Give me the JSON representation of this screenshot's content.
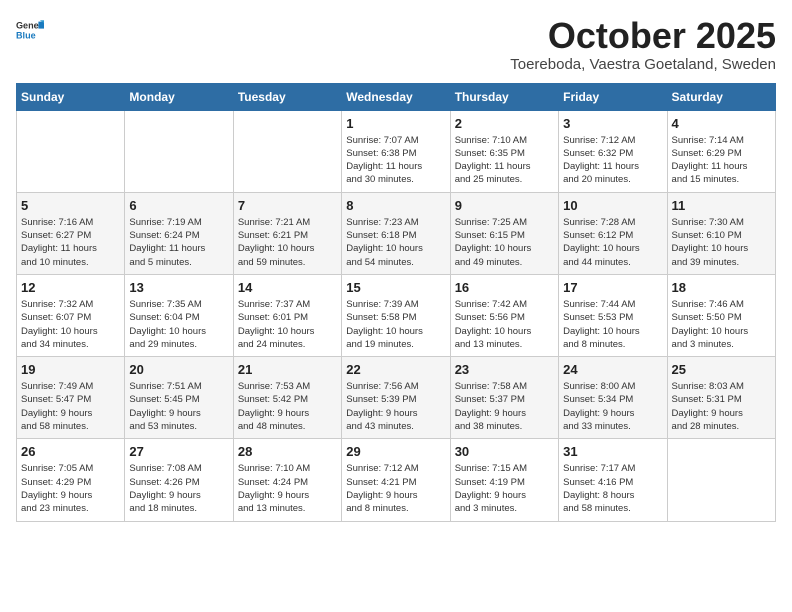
{
  "header": {
    "logo_general": "General",
    "logo_blue": "Blue",
    "month": "October 2025",
    "location": "Toereboda, Vaestra Goetaland, Sweden"
  },
  "weekdays": [
    "Sunday",
    "Monday",
    "Tuesday",
    "Wednesday",
    "Thursday",
    "Friday",
    "Saturday"
  ],
  "weeks": [
    [
      {
        "day": "",
        "info": ""
      },
      {
        "day": "",
        "info": ""
      },
      {
        "day": "",
        "info": ""
      },
      {
        "day": "1",
        "info": "Sunrise: 7:07 AM\nSunset: 6:38 PM\nDaylight: 11 hours\nand 30 minutes."
      },
      {
        "day": "2",
        "info": "Sunrise: 7:10 AM\nSunset: 6:35 PM\nDaylight: 11 hours\nand 25 minutes."
      },
      {
        "day": "3",
        "info": "Sunrise: 7:12 AM\nSunset: 6:32 PM\nDaylight: 11 hours\nand 20 minutes."
      },
      {
        "day": "4",
        "info": "Sunrise: 7:14 AM\nSunset: 6:29 PM\nDaylight: 11 hours\nand 15 minutes."
      }
    ],
    [
      {
        "day": "5",
        "info": "Sunrise: 7:16 AM\nSunset: 6:27 PM\nDaylight: 11 hours\nand 10 minutes."
      },
      {
        "day": "6",
        "info": "Sunrise: 7:19 AM\nSunset: 6:24 PM\nDaylight: 11 hours\nand 5 minutes."
      },
      {
        "day": "7",
        "info": "Sunrise: 7:21 AM\nSunset: 6:21 PM\nDaylight: 10 hours\nand 59 minutes."
      },
      {
        "day": "8",
        "info": "Sunrise: 7:23 AM\nSunset: 6:18 PM\nDaylight: 10 hours\nand 54 minutes."
      },
      {
        "day": "9",
        "info": "Sunrise: 7:25 AM\nSunset: 6:15 PM\nDaylight: 10 hours\nand 49 minutes."
      },
      {
        "day": "10",
        "info": "Sunrise: 7:28 AM\nSunset: 6:12 PM\nDaylight: 10 hours\nand 44 minutes."
      },
      {
        "day": "11",
        "info": "Sunrise: 7:30 AM\nSunset: 6:10 PM\nDaylight: 10 hours\nand 39 minutes."
      }
    ],
    [
      {
        "day": "12",
        "info": "Sunrise: 7:32 AM\nSunset: 6:07 PM\nDaylight: 10 hours\nand 34 minutes."
      },
      {
        "day": "13",
        "info": "Sunrise: 7:35 AM\nSunset: 6:04 PM\nDaylight: 10 hours\nand 29 minutes."
      },
      {
        "day": "14",
        "info": "Sunrise: 7:37 AM\nSunset: 6:01 PM\nDaylight: 10 hours\nand 24 minutes."
      },
      {
        "day": "15",
        "info": "Sunrise: 7:39 AM\nSunset: 5:58 PM\nDaylight: 10 hours\nand 19 minutes."
      },
      {
        "day": "16",
        "info": "Sunrise: 7:42 AM\nSunset: 5:56 PM\nDaylight: 10 hours\nand 13 minutes."
      },
      {
        "day": "17",
        "info": "Sunrise: 7:44 AM\nSunset: 5:53 PM\nDaylight: 10 hours\nand 8 minutes."
      },
      {
        "day": "18",
        "info": "Sunrise: 7:46 AM\nSunset: 5:50 PM\nDaylight: 10 hours\nand 3 minutes."
      }
    ],
    [
      {
        "day": "19",
        "info": "Sunrise: 7:49 AM\nSunset: 5:47 PM\nDaylight: 9 hours\nand 58 minutes."
      },
      {
        "day": "20",
        "info": "Sunrise: 7:51 AM\nSunset: 5:45 PM\nDaylight: 9 hours\nand 53 minutes."
      },
      {
        "day": "21",
        "info": "Sunrise: 7:53 AM\nSunset: 5:42 PM\nDaylight: 9 hours\nand 48 minutes."
      },
      {
        "day": "22",
        "info": "Sunrise: 7:56 AM\nSunset: 5:39 PM\nDaylight: 9 hours\nand 43 minutes."
      },
      {
        "day": "23",
        "info": "Sunrise: 7:58 AM\nSunset: 5:37 PM\nDaylight: 9 hours\nand 38 minutes."
      },
      {
        "day": "24",
        "info": "Sunrise: 8:00 AM\nSunset: 5:34 PM\nDaylight: 9 hours\nand 33 minutes."
      },
      {
        "day": "25",
        "info": "Sunrise: 8:03 AM\nSunset: 5:31 PM\nDaylight: 9 hours\nand 28 minutes."
      }
    ],
    [
      {
        "day": "26",
        "info": "Sunrise: 7:05 AM\nSunset: 4:29 PM\nDaylight: 9 hours\nand 23 minutes."
      },
      {
        "day": "27",
        "info": "Sunrise: 7:08 AM\nSunset: 4:26 PM\nDaylight: 9 hours\nand 18 minutes."
      },
      {
        "day": "28",
        "info": "Sunrise: 7:10 AM\nSunset: 4:24 PM\nDaylight: 9 hours\nand 13 minutes."
      },
      {
        "day": "29",
        "info": "Sunrise: 7:12 AM\nSunset: 4:21 PM\nDaylight: 9 hours\nand 8 minutes."
      },
      {
        "day": "30",
        "info": "Sunrise: 7:15 AM\nSunset: 4:19 PM\nDaylight: 9 hours\nand 3 minutes."
      },
      {
        "day": "31",
        "info": "Sunrise: 7:17 AM\nSunset: 4:16 PM\nDaylight: 8 hours\nand 58 minutes."
      },
      {
        "day": "",
        "info": ""
      }
    ]
  ]
}
